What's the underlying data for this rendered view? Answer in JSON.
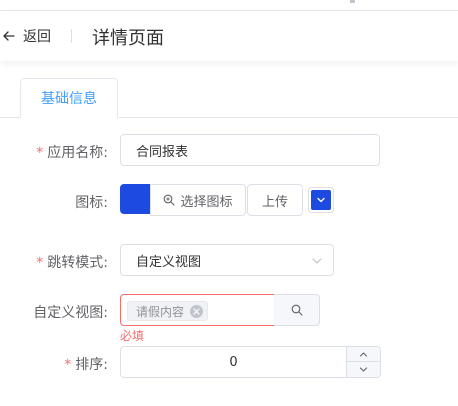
{
  "header": {
    "back_label": "返回",
    "title": "详情页面"
  },
  "tabs": [
    {
      "label": "基础信息",
      "active": true
    }
  ],
  "form": {
    "app_name": {
      "label": "应用名称:",
      "required": true,
      "value": "合同报表"
    },
    "icon": {
      "label": "图标:",
      "swatch_color": "#1d4ae0",
      "pick_label": "选择图标",
      "upload_label": "上传",
      "color_value": "#1d4ae0"
    },
    "jump_mode": {
      "label": "跳转模式:",
      "required": true,
      "value": "自定义视图"
    },
    "custom_view": {
      "label": "自定义视图:",
      "required": false,
      "tag": "请假内容",
      "error": "必填"
    },
    "sort": {
      "label": "排序:",
      "required": true,
      "value": "0"
    }
  },
  "colors": {
    "accent": "#409eff",
    "required": "#f56c6c",
    "error_border": "#f56c6c",
    "text": "#303133",
    "label": "#606266",
    "border": "#dcdfe6"
  },
  "icons": {
    "back": "arrow-left-icon",
    "pick": "search-icon",
    "color_dropdown": "chevron-down-icon",
    "select_arrow": "chevron-down-icon",
    "tag_close": "close-icon",
    "search": "search-icon",
    "increase": "chevron-up-icon",
    "decrease": "chevron-down-icon"
  }
}
